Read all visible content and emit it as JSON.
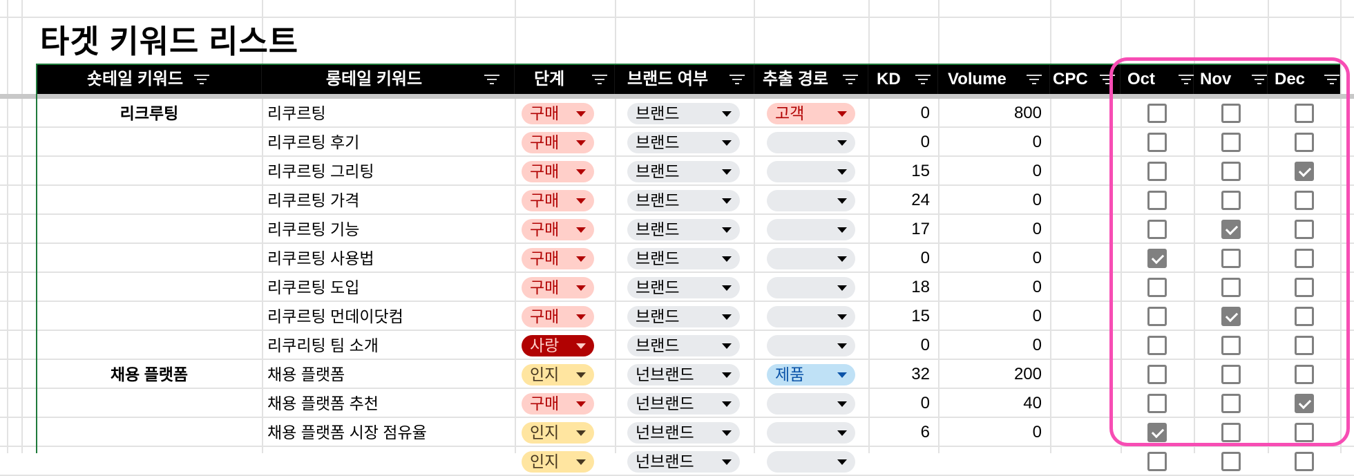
{
  "sheet": {
    "title": "타겟 키워드 리스트",
    "accent_color": "#1e7a3a",
    "highlight_color": "#f74db4"
  },
  "columns": [
    {
      "key": "short_tail",
      "label": "숏테일 키워드"
    },
    {
      "key": "long_tail",
      "label": "롱테일 키워드"
    },
    {
      "key": "stage",
      "label": "단계"
    },
    {
      "key": "brand",
      "label": "브랜드 여부"
    },
    {
      "key": "source",
      "label": "추출 경로"
    },
    {
      "key": "kd",
      "label": "KD"
    },
    {
      "key": "volume",
      "label": "Volume"
    },
    {
      "key": "cpc",
      "label": "CPC"
    },
    {
      "key": "oct",
      "label": "Oct"
    },
    {
      "key": "nov",
      "label": "Nov"
    },
    {
      "key": "dec",
      "label": "Dec"
    }
  ],
  "chip_styles": {
    "구매": "red",
    "사랑": "darkred",
    "인지": "yellow",
    "고객": "red",
    "제품": "blue",
    "브랜드": "gray",
    "넌브랜드": "gray",
    "": "gray"
  },
  "rows": [
    {
      "short_tail": "리크루팅",
      "long_tail": "리쿠르팅",
      "stage": "구매",
      "brand": "브랜드",
      "source": "고객",
      "kd": "0",
      "volume": "800",
      "cpc": "",
      "oct": false,
      "nov": false,
      "dec": false
    },
    {
      "short_tail": "",
      "long_tail": "리쿠르팅 후기",
      "stage": "구매",
      "brand": "브랜드",
      "source": "",
      "kd": "0",
      "volume": "0",
      "cpc": "",
      "oct": false,
      "nov": false,
      "dec": false
    },
    {
      "short_tail": "",
      "long_tail": "리쿠르팅 그리팅",
      "stage": "구매",
      "brand": "브랜드",
      "source": "",
      "kd": "15",
      "volume": "0",
      "cpc": "",
      "oct": false,
      "nov": false,
      "dec": true
    },
    {
      "short_tail": "",
      "long_tail": "리쿠르팅 가격",
      "stage": "구매",
      "brand": "브랜드",
      "source": "",
      "kd": "24",
      "volume": "0",
      "cpc": "",
      "oct": false,
      "nov": false,
      "dec": false
    },
    {
      "short_tail": "",
      "long_tail": "리쿠르팅 기능",
      "stage": "구매",
      "brand": "브랜드",
      "source": "",
      "kd": "17",
      "volume": "0",
      "cpc": "",
      "oct": false,
      "nov": true,
      "dec": false
    },
    {
      "short_tail": "",
      "long_tail": "리쿠르팅 사용법",
      "stage": "구매",
      "brand": "브랜드",
      "source": "",
      "kd": "0",
      "volume": "0",
      "cpc": "",
      "oct": true,
      "nov": false,
      "dec": false
    },
    {
      "short_tail": "",
      "long_tail": "리쿠르팅 도입",
      "stage": "구매",
      "brand": "브랜드",
      "source": "",
      "kd": "18",
      "volume": "0",
      "cpc": "",
      "oct": false,
      "nov": false,
      "dec": false
    },
    {
      "short_tail": "",
      "long_tail": "리쿠르팅 먼데이닷컴",
      "stage": "구매",
      "brand": "브랜드",
      "source": "",
      "kd": "15",
      "volume": "0",
      "cpc": "",
      "oct": false,
      "nov": true,
      "dec": false
    },
    {
      "short_tail": "",
      "long_tail": "리쿠리팅 팀 소개",
      "stage": "사랑",
      "brand": "브랜드",
      "source": "",
      "kd": "0",
      "volume": "0",
      "cpc": "",
      "oct": false,
      "nov": false,
      "dec": false
    },
    {
      "short_tail": "채용 플랫폼",
      "long_tail": "채용 플랫폼",
      "stage": "인지",
      "brand": "넌브랜드",
      "source": "제품",
      "kd": "32",
      "volume": "200",
      "cpc": "",
      "oct": false,
      "nov": false,
      "dec": false
    },
    {
      "short_tail": "",
      "long_tail": "채용 플랫폼 추천",
      "stage": "구매",
      "brand": "넌브랜드",
      "source": "",
      "kd": "0",
      "volume": "40",
      "cpc": "",
      "oct": false,
      "nov": false,
      "dec": true
    },
    {
      "short_tail": "",
      "long_tail": "채용 플랫폼 시장 점유율",
      "stage": "인지",
      "brand": "넌브랜드",
      "source": "",
      "kd": "6",
      "volume": "0",
      "cpc": "",
      "oct": true,
      "nov": false,
      "dec": false
    },
    {
      "short_tail": "",
      "long_tail": "",
      "stage": "인지",
      "brand": "넌브랜드",
      "source": "",
      "kd": "",
      "volume": "",
      "cpc": "",
      "oct": false,
      "nov": false,
      "dec": false
    }
  ]
}
